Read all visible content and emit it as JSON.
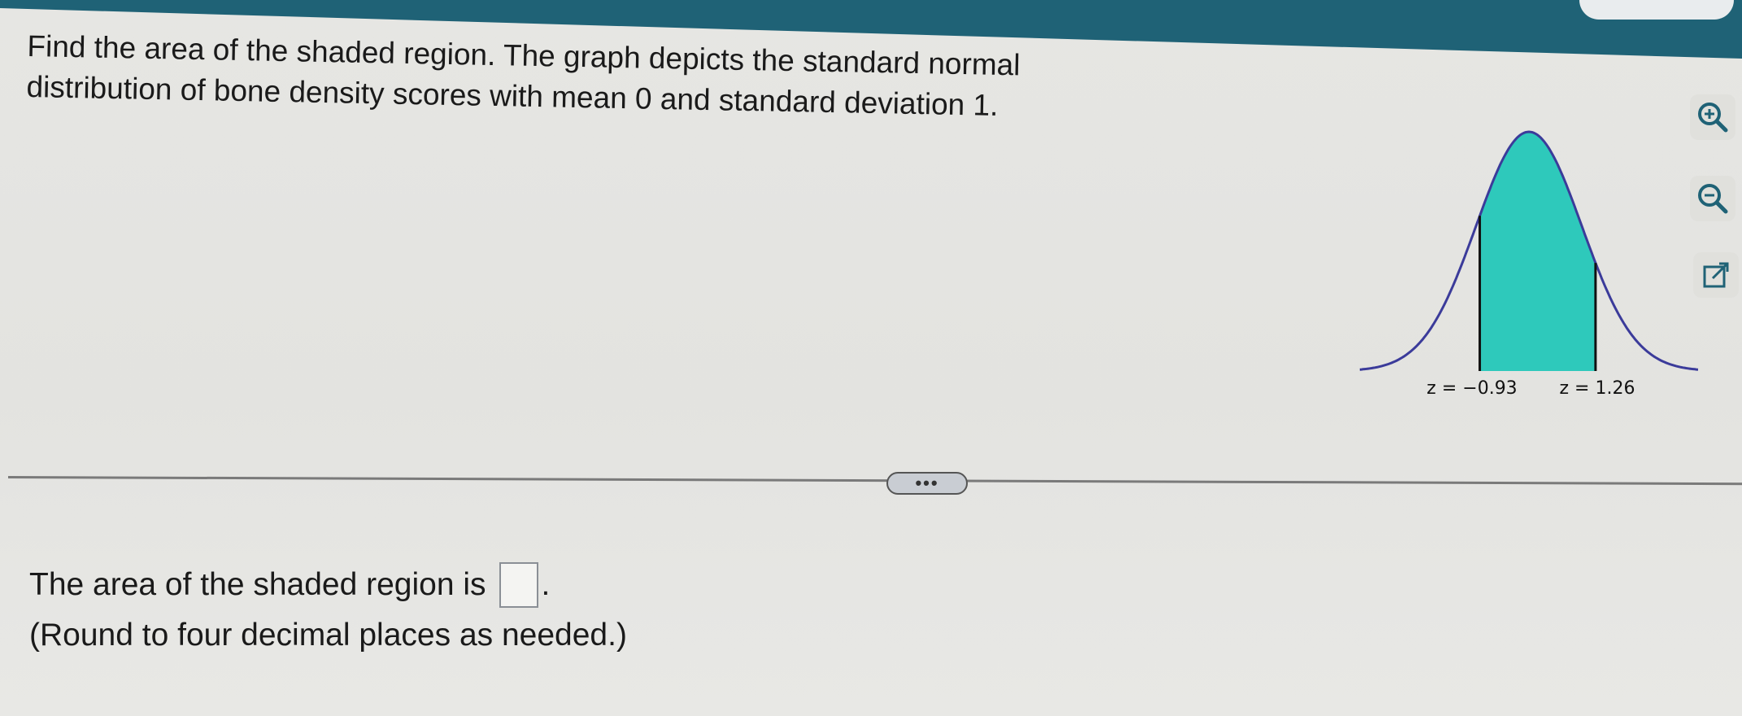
{
  "question": {
    "line1": "Find the area of the shaded region. The graph depicts the standard normal",
    "line2": "distribution of bone density scores with mean 0 and standard deviation 1."
  },
  "graph": {
    "left_label": "z = −0.93",
    "right_label": "z = 1.26",
    "shade_color": "#2ec9bb",
    "curve_color": "#3b3b9a"
  },
  "toolbar": {
    "zoom_in_icon": "zoom-in-icon",
    "zoom_out_icon": "zoom-out-icon",
    "popout_icon": "popout-icon"
  },
  "divider": {
    "more_label": "•••"
  },
  "answer": {
    "prefix": "The area of the shaded region is",
    "suffix": ".",
    "hint": "(Round to four decimal places as needed.)",
    "value": ""
  }
}
